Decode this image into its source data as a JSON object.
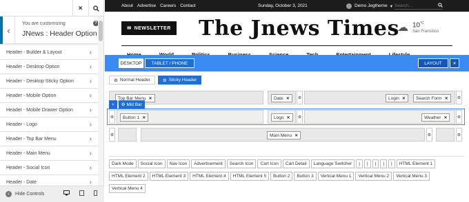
{
  "sidebar": {
    "customizing_label": "You are customizing",
    "title": "JNews : Header Option",
    "help": "?",
    "close": "×",
    "search_icon": "magnifier",
    "back_icon": "‹",
    "items": [
      {
        "label": "Header - Builder & Layout"
      },
      {
        "label": "Header - Desktop Option"
      },
      {
        "label": "Header - Desktop Sticky Option"
      },
      {
        "label": "Header - Mobile Option"
      },
      {
        "label": "Header - Mobile Drawer Option"
      },
      {
        "label": "Header - Logo"
      },
      {
        "label": "Header - Top Bar Menu"
      },
      {
        "label": "Header - Main Menu"
      },
      {
        "label": "Header - Social Icon"
      },
      {
        "label": "Header - Date"
      }
    ],
    "footer": {
      "hide_controls": "Hide Controls"
    }
  },
  "site": {
    "topbar": {
      "links": [
        "About",
        "Advertise",
        "Careers",
        "Contact"
      ],
      "date": "Sunday, October 3, 2021",
      "user": "Demo Jegtheme",
      "search_placeholder": "Search..."
    },
    "newsletter": "NEWSLETTER",
    "logo": "The Jnews Times",
    "weather": {
      "temp": "10",
      "unit": "°C",
      "city": "San Francisco"
    },
    "nav": [
      "Home",
      "World",
      "Politics",
      "Business",
      "Science",
      "Tech",
      "Entertainment",
      "Lifestyle"
    ]
  },
  "builder": {
    "tabs": {
      "desktop": "DESKTOP",
      "tablet": "TABLET / PHONE"
    },
    "layout": "LAYOUT",
    "close": "×",
    "header_tabs": {
      "normal": "Normal Header",
      "sticky": "Sticky Header"
    },
    "midbar": {
      "plus": "+",
      "label": "Mid Bar"
    },
    "rows": {
      "top_left": "Top Bar Menu",
      "top_center": "Date",
      "top_right_1": "Login",
      "top_right_2": "Search Form",
      "mid_left": "Button 1",
      "mid_center": "Logo",
      "mid_right": "Weather",
      "bottom_center": "Main Menu"
    },
    "palette": [
      "Dark Mode",
      "Social Icon",
      "Nav Icon",
      "Advertisement",
      "Search Icon",
      "Cart Icon",
      "Cart Detail",
      "Language Switcher",
      "|",
      "|",
      "|",
      "|",
      "|",
      "HTML Element 1",
      "HTML Element 2",
      "HTML Element 3",
      "HTML Element 4",
      "HTML Element 5",
      "Button 2",
      "Button 3",
      "Vertical Menu 1",
      "Vertical Menu 2",
      "Vertical Menu 3",
      "Vertical Menu 4"
    ]
  },
  "colors": {
    "accent": "#3b8cf2",
    "accent_dark": "#1d6fd6",
    "topbar": "#1c1c1c"
  }
}
